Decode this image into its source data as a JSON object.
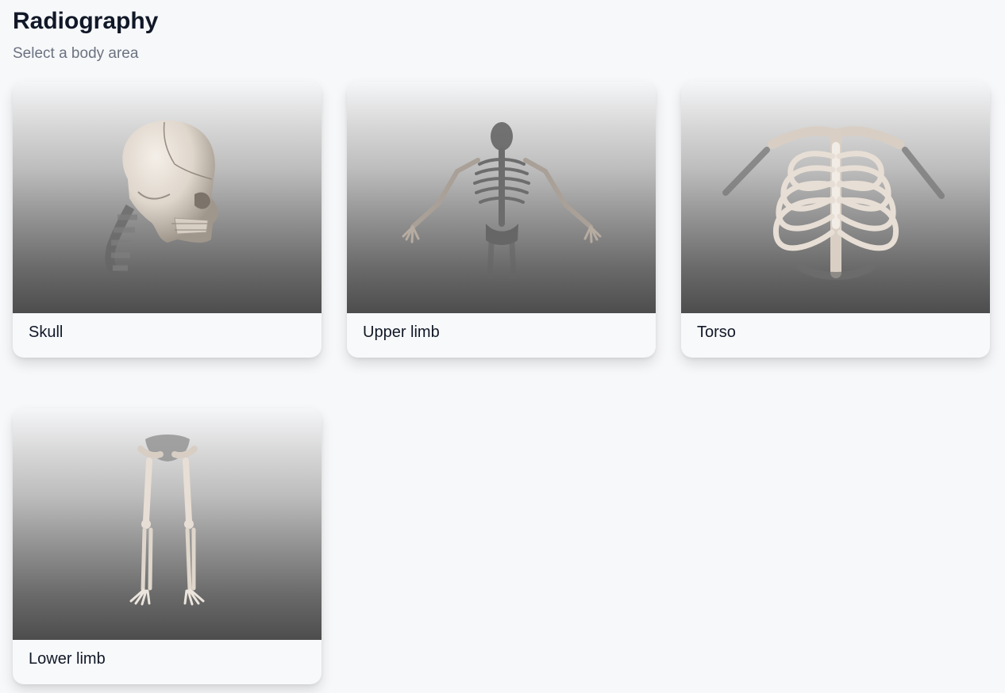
{
  "page": {
    "title": "Radiography",
    "subtitle": "Select a body area"
  },
  "areas": [
    {
      "label": "Skull",
      "image_icon": "skull-image"
    },
    {
      "label": "Upper limb",
      "image_icon": "upper-limb-skeleton-image"
    },
    {
      "label": "Torso",
      "image_icon": "torso-skeleton-image"
    },
    {
      "label": "Lower limb",
      "image_icon": "lower-limb-skeleton-image"
    }
  ],
  "colors": {
    "background": "#f7f8fa",
    "card": "#f8f9fb",
    "title": "#111827",
    "subtitle": "#6b7280",
    "bone": "#e8e0d6",
    "bone_shadow": "#b7aca1"
  }
}
